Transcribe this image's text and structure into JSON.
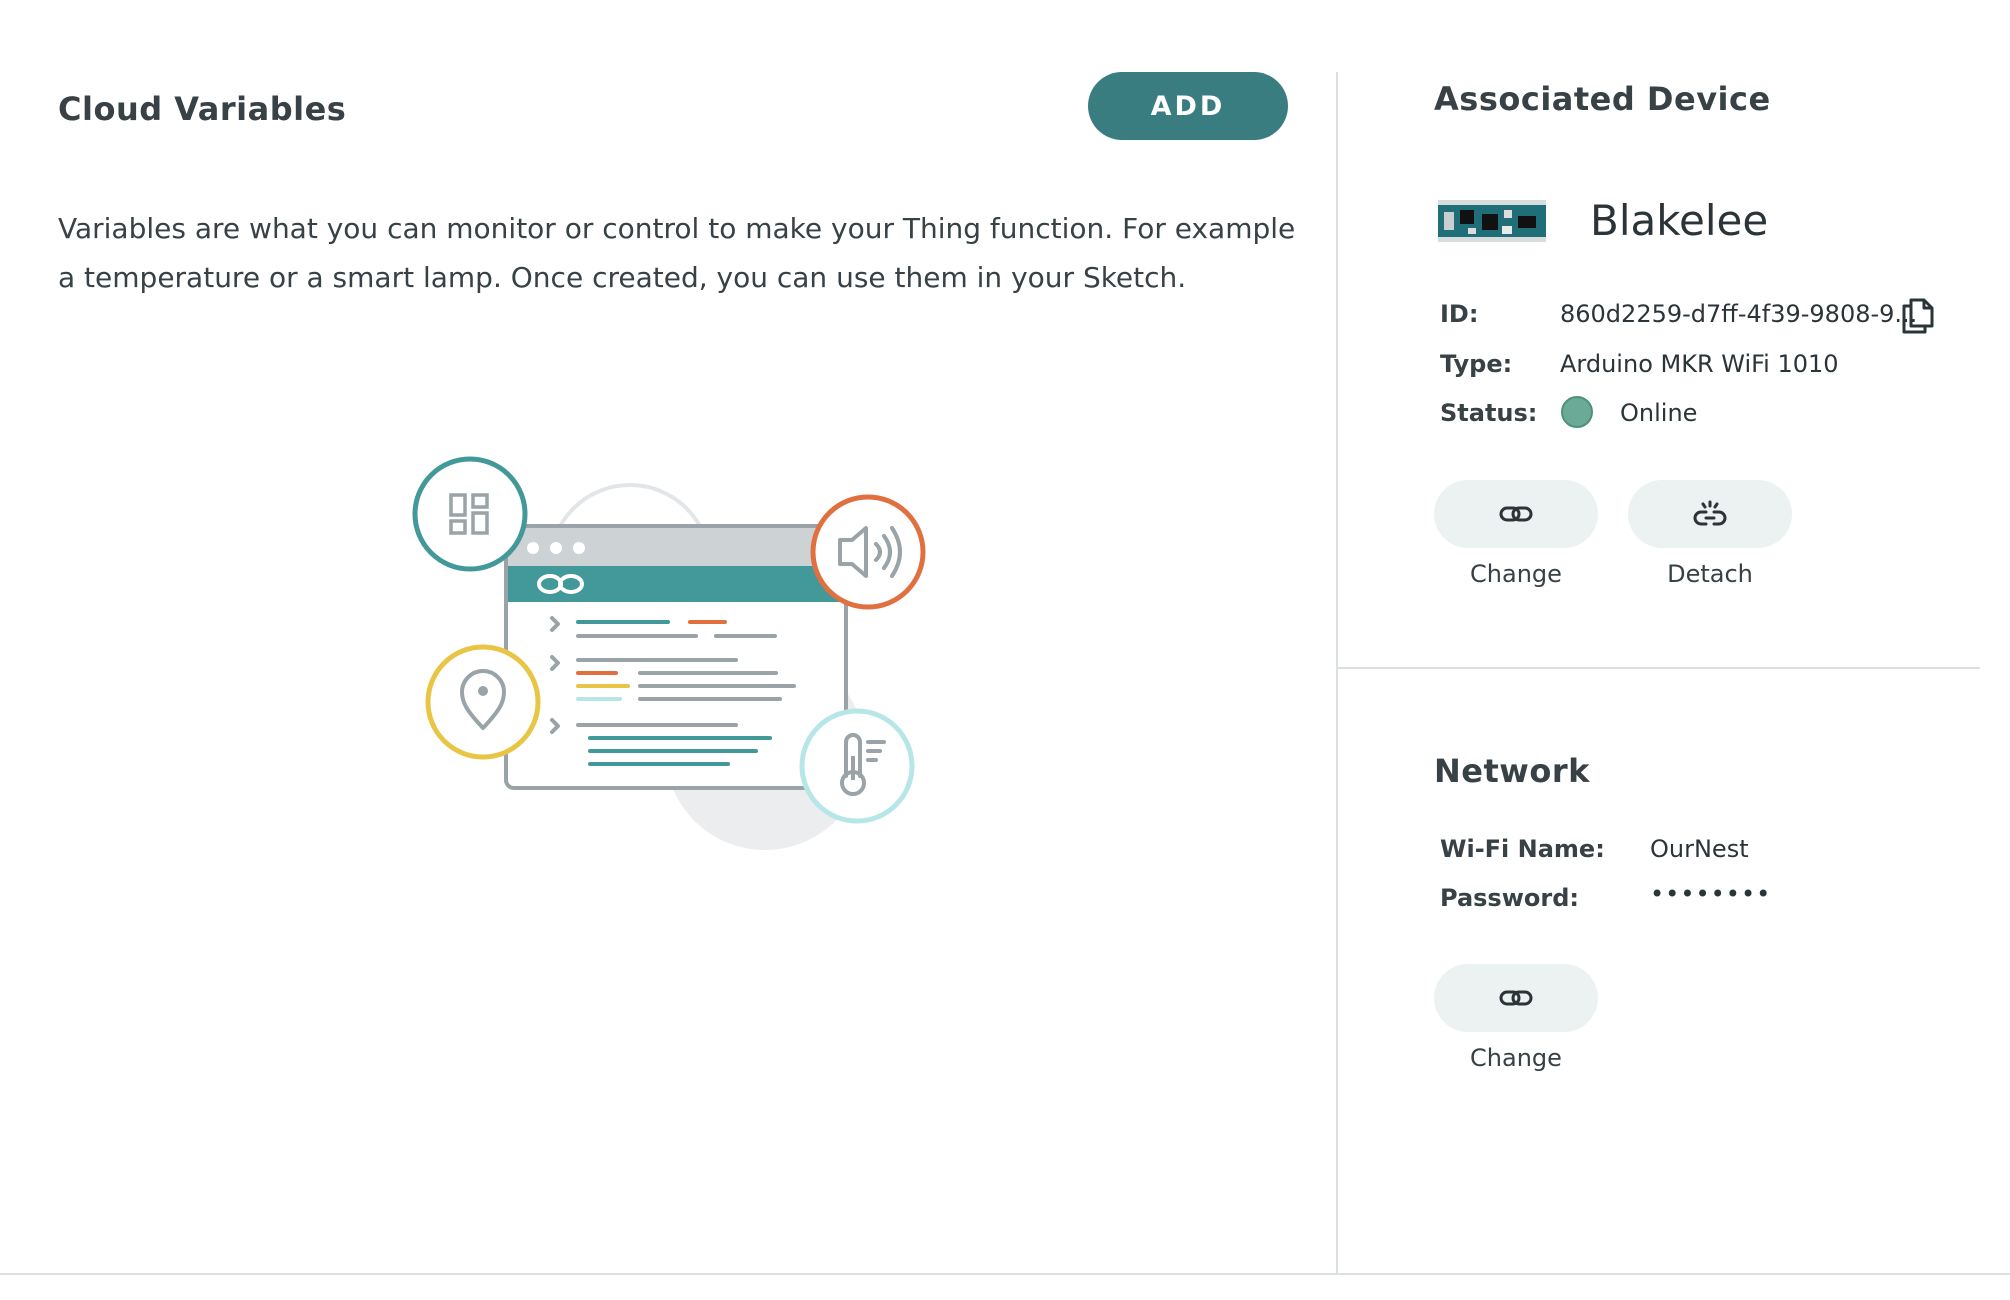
{
  "cloud_variables": {
    "title": "Cloud Variables",
    "add_label": "ADD",
    "description": "Variables are what you can monitor or control to make your Thing function. For example a temperature or a smart lamp. Once created, you can use them in your Sketch."
  },
  "associated_device": {
    "title": "Associated Device",
    "device_name": "Blakelee",
    "id_label": "ID:",
    "id_value": "860d2259-d7ff-4f39-9808-9...",
    "type_label": "Type:",
    "type_value": "Arduino MKR WiFi 1010",
    "status_label": "Status:",
    "status_value": "Online",
    "status_color": "#6aaa96",
    "change_label": "Change",
    "detach_label": "Detach"
  },
  "network": {
    "title": "Network",
    "wifi_label": "Wi-Fi Name:",
    "wifi_value": "OurNest",
    "password_label": "Password:",
    "password_value": "••••••••",
    "change_label": "Change"
  },
  "colors": {
    "accent": "#3a7d80",
    "text": "#374146",
    "button_bg": "#ecf1f1",
    "divider": "#dadfe2",
    "orange": "#e0703f",
    "yellow": "#e8c544",
    "light_cyan": "#b7e6e8"
  },
  "icons": {
    "link": "link-icon",
    "unlink": "unlink-icon",
    "copy": "copy-icon"
  }
}
